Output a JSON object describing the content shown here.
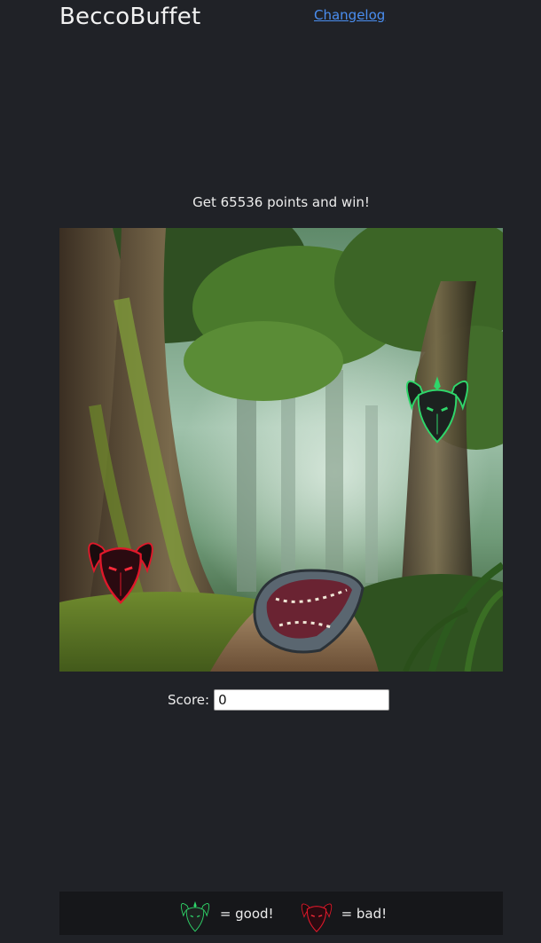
{
  "header": {
    "brand": "BeccoBuffet",
    "changelog_link": "Changelog"
  },
  "game": {
    "goal_text": "Get 65536 points and win!",
    "scene": "misty forest path with giant mossy trees",
    "sprites": {
      "good_goat_icon": "green-goat-icon",
      "bad_goat_icon": "red-goat-icon",
      "player_icon": "open-mouth-icon"
    }
  },
  "score": {
    "label": "Score:",
    "value": "0"
  },
  "legend": {
    "good_text": "= good!",
    "bad_text": "= bad!"
  },
  "colors": {
    "page_background": "#202227",
    "link": "#4a8ef0",
    "legend_background": "#16171a",
    "good_accent": "#2fd66a",
    "bad_accent": "#e0182a"
  }
}
